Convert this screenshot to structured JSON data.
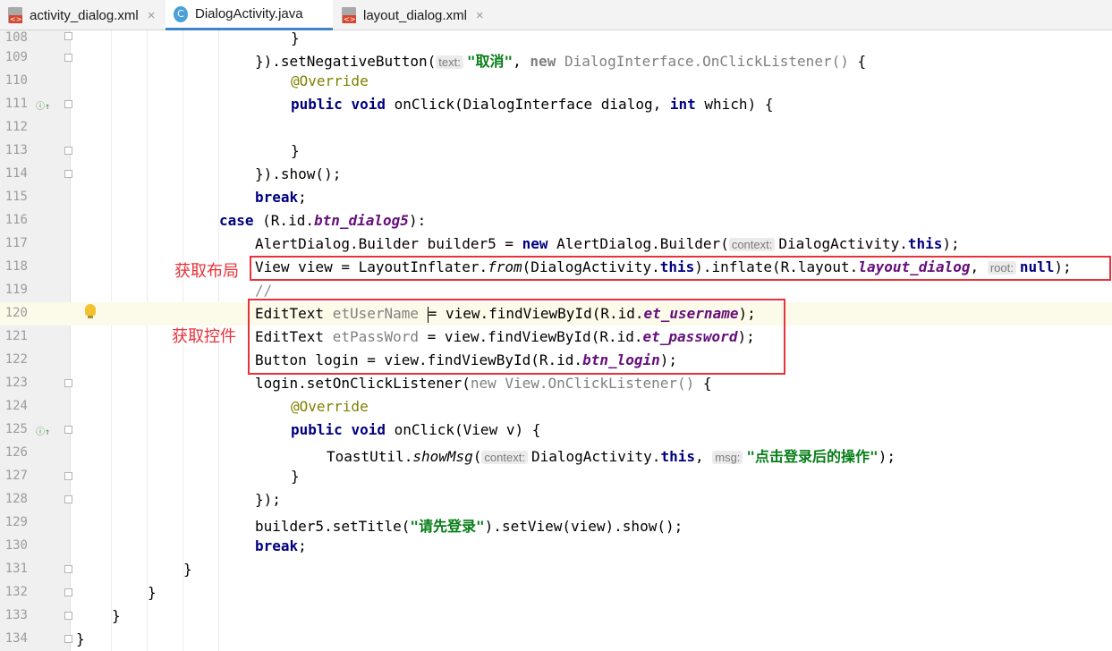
{
  "tabs": [
    {
      "label": "activity_dialog.xml",
      "icon": "xml-file-icon",
      "active": false
    },
    {
      "label": "DialogActivity.java",
      "icon": "java-class-icon",
      "active": true
    },
    {
      "label": "layout_dialog.xml",
      "icon": "xml-file-icon",
      "active": false
    }
  ],
  "tab_close_glyph": "×",
  "java_icon_letter": "C",
  "line_numbers": [
    "108",
    "109",
    "110",
    "111",
    "112",
    "113",
    "114",
    "115",
    "116",
    "117",
    "118",
    "119",
    "120",
    "121",
    "122",
    "123",
    "124",
    "125",
    "126",
    "127",
    "128",
    "129",
    "130",
    "131",
    "132",
    "133",
    "134"
  ],
  "code": {
    "l108": {
      "t1": "}"
    },
    "l109": {
      "t1": "}).setNegativeButton(",
      "h1": "text:",
      "s1": "\"取消\"",
      "t2": ", ",
      "k1": "new",
      "u1": " DialogInterface.OnClickListener()",
      "t3": " {"
    },
    "l110": {
      "a1": "@Override"
    },
    "l111": {
      "k1": "public",
      "t1": " ",
      "k2": "void",
      "t2": " onClick(DialogInterface dialog, ",
      "k3": "int",
      "t3": " which) {"
    },
    "l113": {
      "t1": "}"
    },
    "l114": {
      "t1": "}).show();"
    },
    "l115": {
      "k1": "break",
      "t1": ";"
    },
    "l116": {
      "k1": "case",
      "t1": " (R.id.",
      "f1": "btn_dialog5",
      "t2": "):"
    },
    "l117": {
      "t1": "AlertDialog.Builder builder5 = ",
      "k1": "new",
      "t2": " AlertDialog.Builder(",
      "h1": "context:",
      "t3": "DialogActivity.",
      "k2": "this",
      "t4": ");"
    },
    "l118": {
      "t1": "View view = LayoutInflater.",
      "i1": "from",
      "t2": "(DialogActivity.",
      "k1": "this",
      "t3": ").inflate(R.layout.",
      "f1": "layout_dialog",
      "t4": ", ",
      "h1": "root:",
      "k2": "null",
      "t5": ");"
    },
    "l119": {
      "c1": "//"
    },
    "l120": {
      "t1": "EditText ",
      "u1": "etUserName",
      "t2": " ",
      "t3": "= view.findViewById(R.id.",
      "f1": "et_username",
      "t4": ");"
    },
    "l121": {
      "t1": "EditText ",
      "u1": "etPassWord",
      "t2": " = view.findViewById(R.id.",
      "f1": "et_password",
      "t3": ");"
    },
    "l122": {
      "t1": "Button login = view.findViewById(R.id.",
      "f1": "btn_login",
      "t2": ");"
    },
    "l123": {
      "t1": "login.setOnClickListener(",
      "k1": "new",
      "u1": " View.OnClickListener()",
      "t2": " {"
    },
    "l124": {
      "a1": "@Override"
    },
    "l125": {
      "k1": "public",
      "t1": " ",
      "k2": "void",
      "t2": " onClick(View v) {"
    },
    "l126": {
      "t1": "ToastUtil.",
      "i1": "showMsg",
      "t2": "(",
      "h1": "context:",
      "t3": "DialogActivity.",
      "k1": "this",
      "t4": ", ",
      "h2": "msg:",
      "s1": "\"点击登录后的操作\"",
      "t5": ");"
    },
    "l127": {
      "t1": "}"
    },
    "l128": {
      "t1": "});"
    },
    "l129": {
      "t1": "builder5.setTitle(",
      "s1": "\"请先登录\"",
      "t2": ").setView(view).show();"
    },
    "l130": {
      "k1": "break",
      "t1": ";"
    },
    "l131": {
      "t1": "}"
    },
    "l132": {
      "t1": "}"
    },
    "l133": {
      "t1": "}"
    },
    "l134": {
      "t1": "}"
    }
  },
  "annotations": {
    "get_layout": "获取布局",
    "get_controls": "获取控件"
  },
  "colors": {
    "annotation_red": "#e8323a",
    "keyword": "#000080",
    "string": "#067d17",
    "field": "#660e7a",
    "active_tab_underline": "#4083c9"
  },
  "gutter_icons": {
    "override_marker": "ⓘ↑",
    "intention_bulb": "lightbulb-icon"
  }
}
